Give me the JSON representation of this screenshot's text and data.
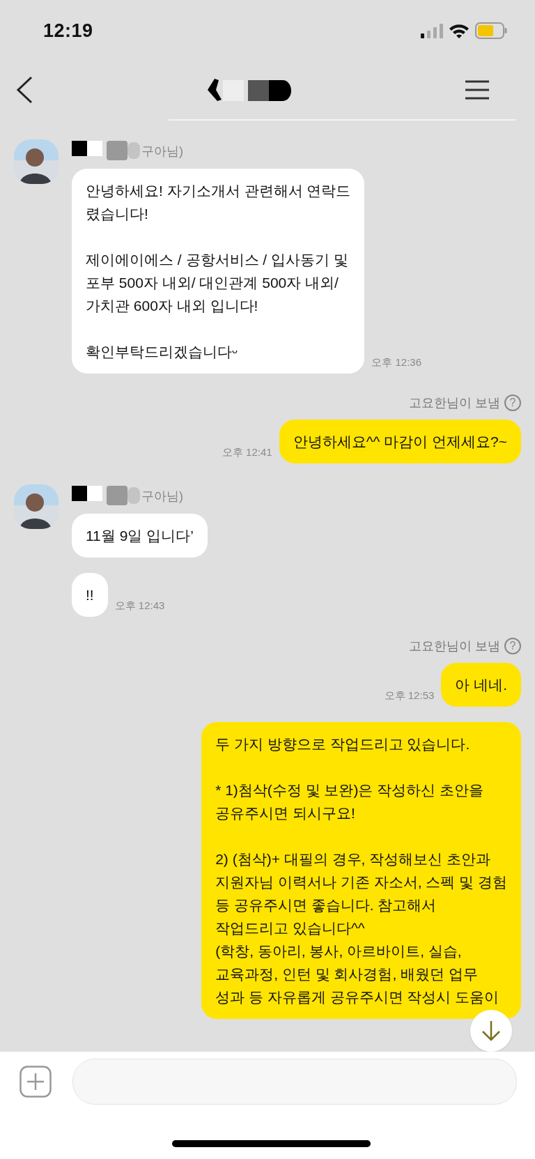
{
  "status_bar": {
    "time": "12:19"
  },
  "messages": [
    {
      "kind": "received",
      "show_profile": true,
      "sender": "구아님)",
      "text": "안녕하세요! 자기소개서 관련해서 연락드\n렸습니다!\n\n제이에이에스 / 공항서비스 / 입사동기 및\n포부 500자 내외/ 대인관계 500자 내외/\n가치관 600자 내외 입니다!\n\n확인부탁드리겠습니다ᵕ",
      "time": "오후 12:36"
    },
    {
      "kind": "sent",
      "sent_label": "고요한님이 보냄",
      "help_mark": "?",
      "text": "안녕하세요^^ 마감이 언제세요?~",
      "time": "오후 12:41"
    },
    {
      "kind": "received",
      "show_profile": true,
      "sender": "구아님)",
      "text": "11월 9일 입니다’"
    },
    {
      "kind": "received",
      "show_profile": false,
      "text": "!!",
      "time": "오후 12:43"
    },
    {
      "kind": "sent",
      "sent_label": "고요한님이 보냄",
      "help_mark": "?",
      "text": "아 네네.",
      "time": "오후 12:53"
    },
    {
      "kind": "sent",
      "text": "두 가지 방향으로 작업드리고 있습니다.\n\n* 1)첨삭(수정 및 보완)은 작성하신 초안을\n공유주시면 되시구요!\n\n2) (첨삭)+ 대필의 경우, 작성해보신 초안과\n지원자님 이력서나 기존 자소서, 스펙 및 경험\n등 공유주시면 좋습니다. 참고해서\n작업드리고 있습니다^^\n(학창, 동아리, 봉사, 아르바이트, 실습,\n교육과정, 인턴 및 회사경험, 배웠던 업무\n성과 등 자유롭게 공유주시면 작성시 도움이"
    }
  ]
}
